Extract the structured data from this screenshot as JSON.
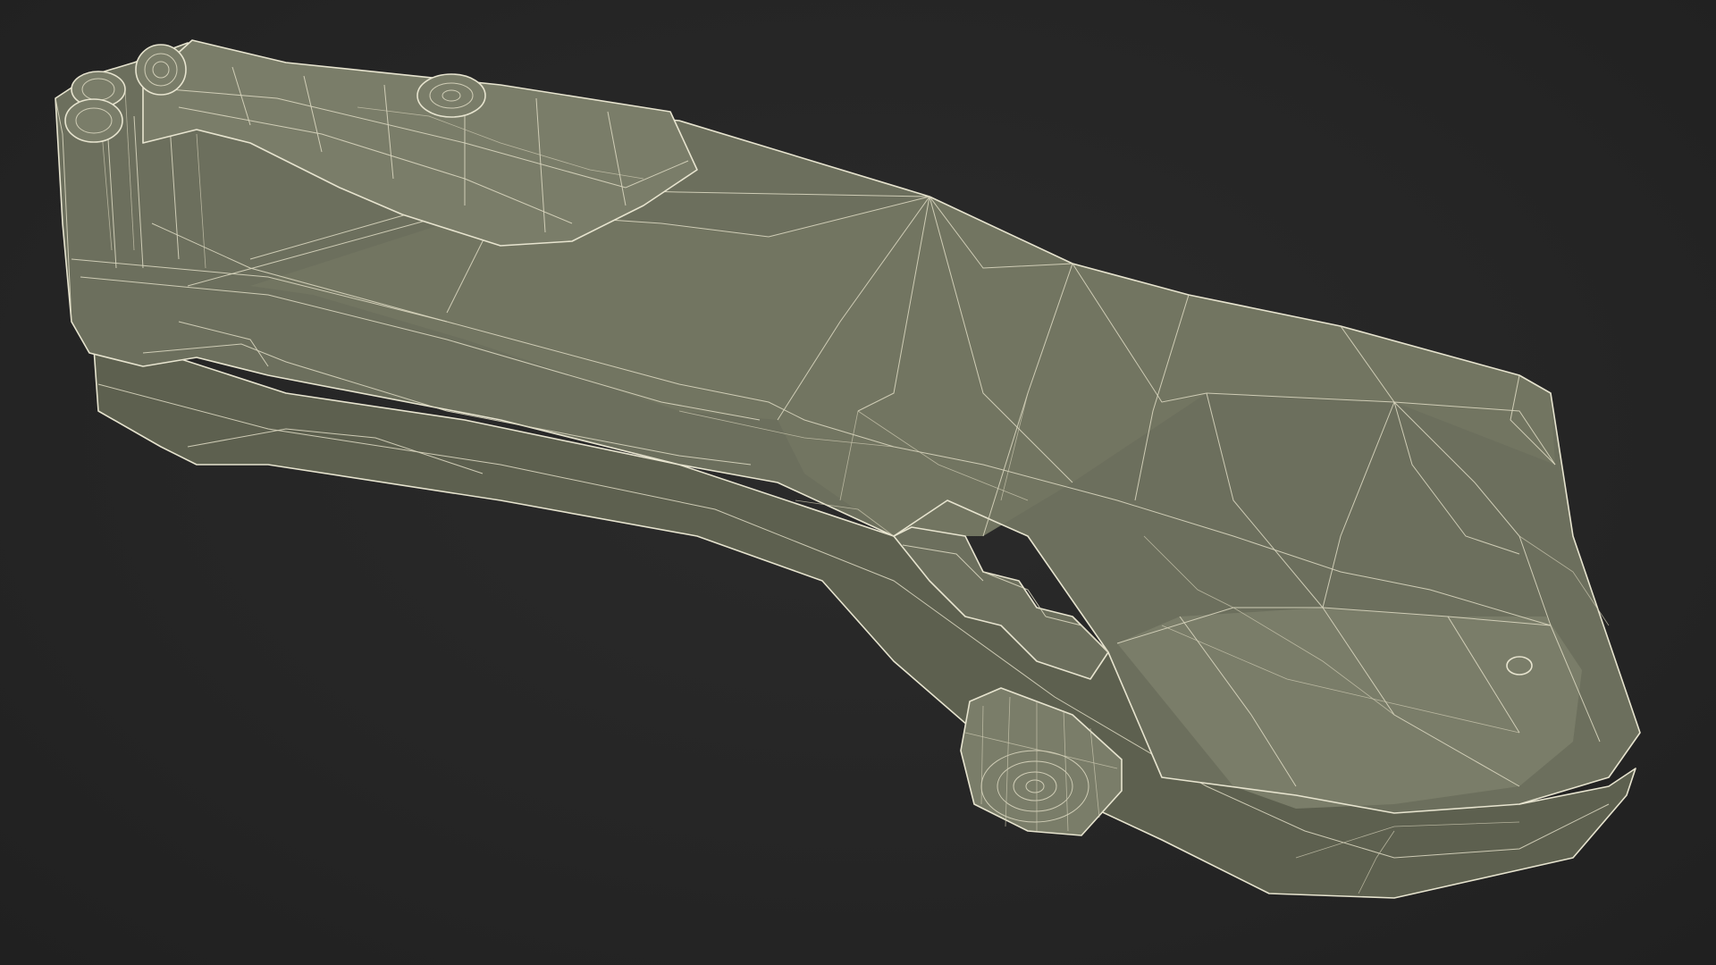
{
  "scene": {
    "subject": "wireframe-folding-knife-handle",
    "background_color": "#262626",
    "mesh_fill_color": "#6c6f5d",
    "wire_color": "#e7e4cf"
  }
}
